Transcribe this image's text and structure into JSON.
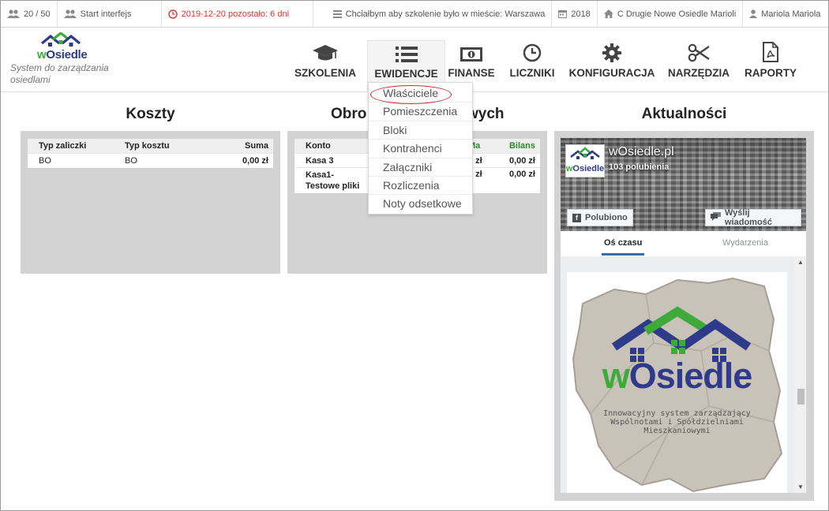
{
  "topbar": {
    "users_count": "20 / 50",
    "start_label": "Start interfejs",
    "deadline": "2019-12-20 pozostało: 6 dni",
    "training_request": "Chciałbym aby szkolenie było w mieście: Warszawa",
    "year": "2018",
    "estate": "C Drugie Nowe Osiedle Marioli",
    "user": "Mariola Mariola"
  },
  "brand": {
    "logo_text": "wOsiedle",
    "tagline": "System do zarządzania osiedlami"
  },
  "nav": {
    "items": [
      {
        "label": "SZKOLENIA",
        "icon": "graduation-cap-icon"
      },
      {
        "label": "EWIDENCJE",
        "icon": "list-icon"
      },
      {
        "label": "FINANSE",
        "icon": "money-icon"
      },
      {
        "label": "LICZNIKI",
        "icon": "clock-icon"
      },
      {
        "label": "KONFIGURACJA",
        "icon": "gear-icon"
      },
      {
        "label": "NARZĘDZIA",
        "icon": "scissors-icon"
      },
      {
        "label": "RAPORTY",
        "icon": "pdf-icon"
      }
    ],
    "active": "EWIDENCJE"
  },
  "dropdown": {
    "items": [
      "Właściciele",
      "Pomieszczenia",
      "Bloki",
      "Kontrahenci",
      "Załączniki",
      "Rozliczenia",
      "Noty odsetkowe"
    ],
    "highlighted": "Właściciele"
  },
  "koszty": {
    "title": "Koszty",
    "headers": [
      "Typ zaliczki",
      "Typ kosztu",
      "Suma"
    ],
    "rows": [
      [
        "BO",
        "BO",
        "0,00 zł"
      ]
    ]
  },
  "obroty": {
    "title_left": "Obro",
    "title_right": "wych",
    "headers": [
      "Konto",
      "Ma",
      "Bilans"
    ],
    "rows": [
      [
        "Kasa 3",
        "0 zł",
        "0,00 zł"
      ],
      [
        "Kasa1-Testowe pliki",
        "0 zł",
        "0,00 zł"
      ]
    ]
  },
  "news": {
    "title": "Aktualności",
    "fb": {
      "page_name": "wOsiedle.pl",
      "likes": "103 polubienia",
      "liked_btn": "Polubiono",
      "message_btn": "Wyślij wiadomość",
      "tab_timeline": "Oś czasu",
      "tab_events": "Wydarzenia",
      "post_logo": "wOsiedle",
      "post_caption_1": "Innowacyjny system zarządzający",
      "post_caption_2": "Wspólnotami i Spółdzielniami",
      "post_caption_3": "Mieszkaniowymi"
    }
  },
  "colors": {
    "brand_blue": "#2e3a8a",
    "brand_green": "#3daa3a",
    "alert_red": "#d9382e",
    "panel_grey": "#d3d3d3",
    "fb_blue": "#4267b2"
  }
}
